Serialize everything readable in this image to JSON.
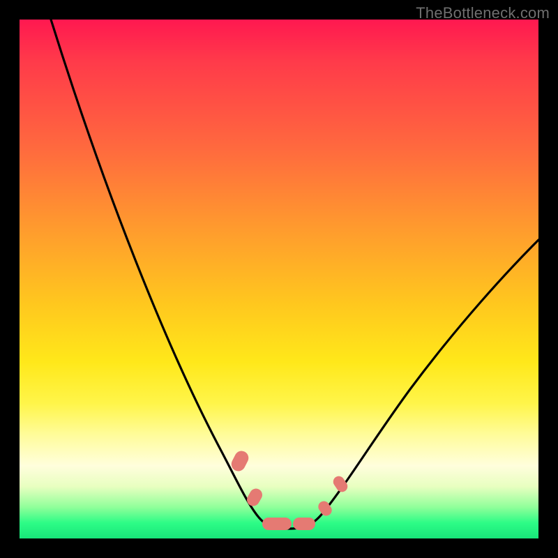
{
  "watermark": {
    "text": "TheBottleneck.com"
  },
  "chart_data": {
    "type": "line",
    "title": "",
    "xlabel": "",
    "ylabel": "",
    "xlim": [
      0,
      100
    ],
    "ylim": [
      0,
      100
    ],
    "series": [
      {
        "name": "bottleneck-curve",
        "x": [
          6,
          10,
          15,
          20,
          25,
          30,
          35,
          40,
          43,
          46,
          49,
          52,
          55,
          58,
          62,
          66,
          70,
          75,
          80,
          85,
          90,
          95,
          100
        ],
        "values": [
          100,
          90,
          79,
          67,
          56,
          45,
          34,
          22,
          14,
          8,
          4,
          3,
          3,
          4,
          8,
          14,
          20,
          27,
          34,
          40,
          46,
          52,
          57
        ]
      }
    ],
    "markers": [
      {
        "name": "left-upper",
        "x": 42.5,
        "y": 15
      },
      {
        "name": "left-lower",
        "x": 45.5,
        "y": 8
      },
      {
        "name": "flat-1",
        "x": 49.0,
        "y": 3.2
      },
      {
        "name": "flat-2",
        "x": 52.5,
        "y": 3.0
      },
      {
        "name": "flat-3",
        "x": 56.0,
        "y": 3.2
      },
      {
        "name": "right-lower",
        "x": 60.0,
        "y": 6
      },
      {
        "name": "right-upper",
        "x": 63.0,
        "y": 11
      }
    ],
    "gradient_stops": [
      {
        "pos": 0,
        "color": "#ff1850"
      },
      {
        "pos": 25,
        "color": "#ff6a3e"
      },
      {
        "pos": 55,
        "color": "#ffc81e"
      },
      {
        "pos": 80,
        "color": "#fffc9a"
      },
      {
        "pos": 97,
        "color": "#2dfc86"
      }
    ]
  }
}
